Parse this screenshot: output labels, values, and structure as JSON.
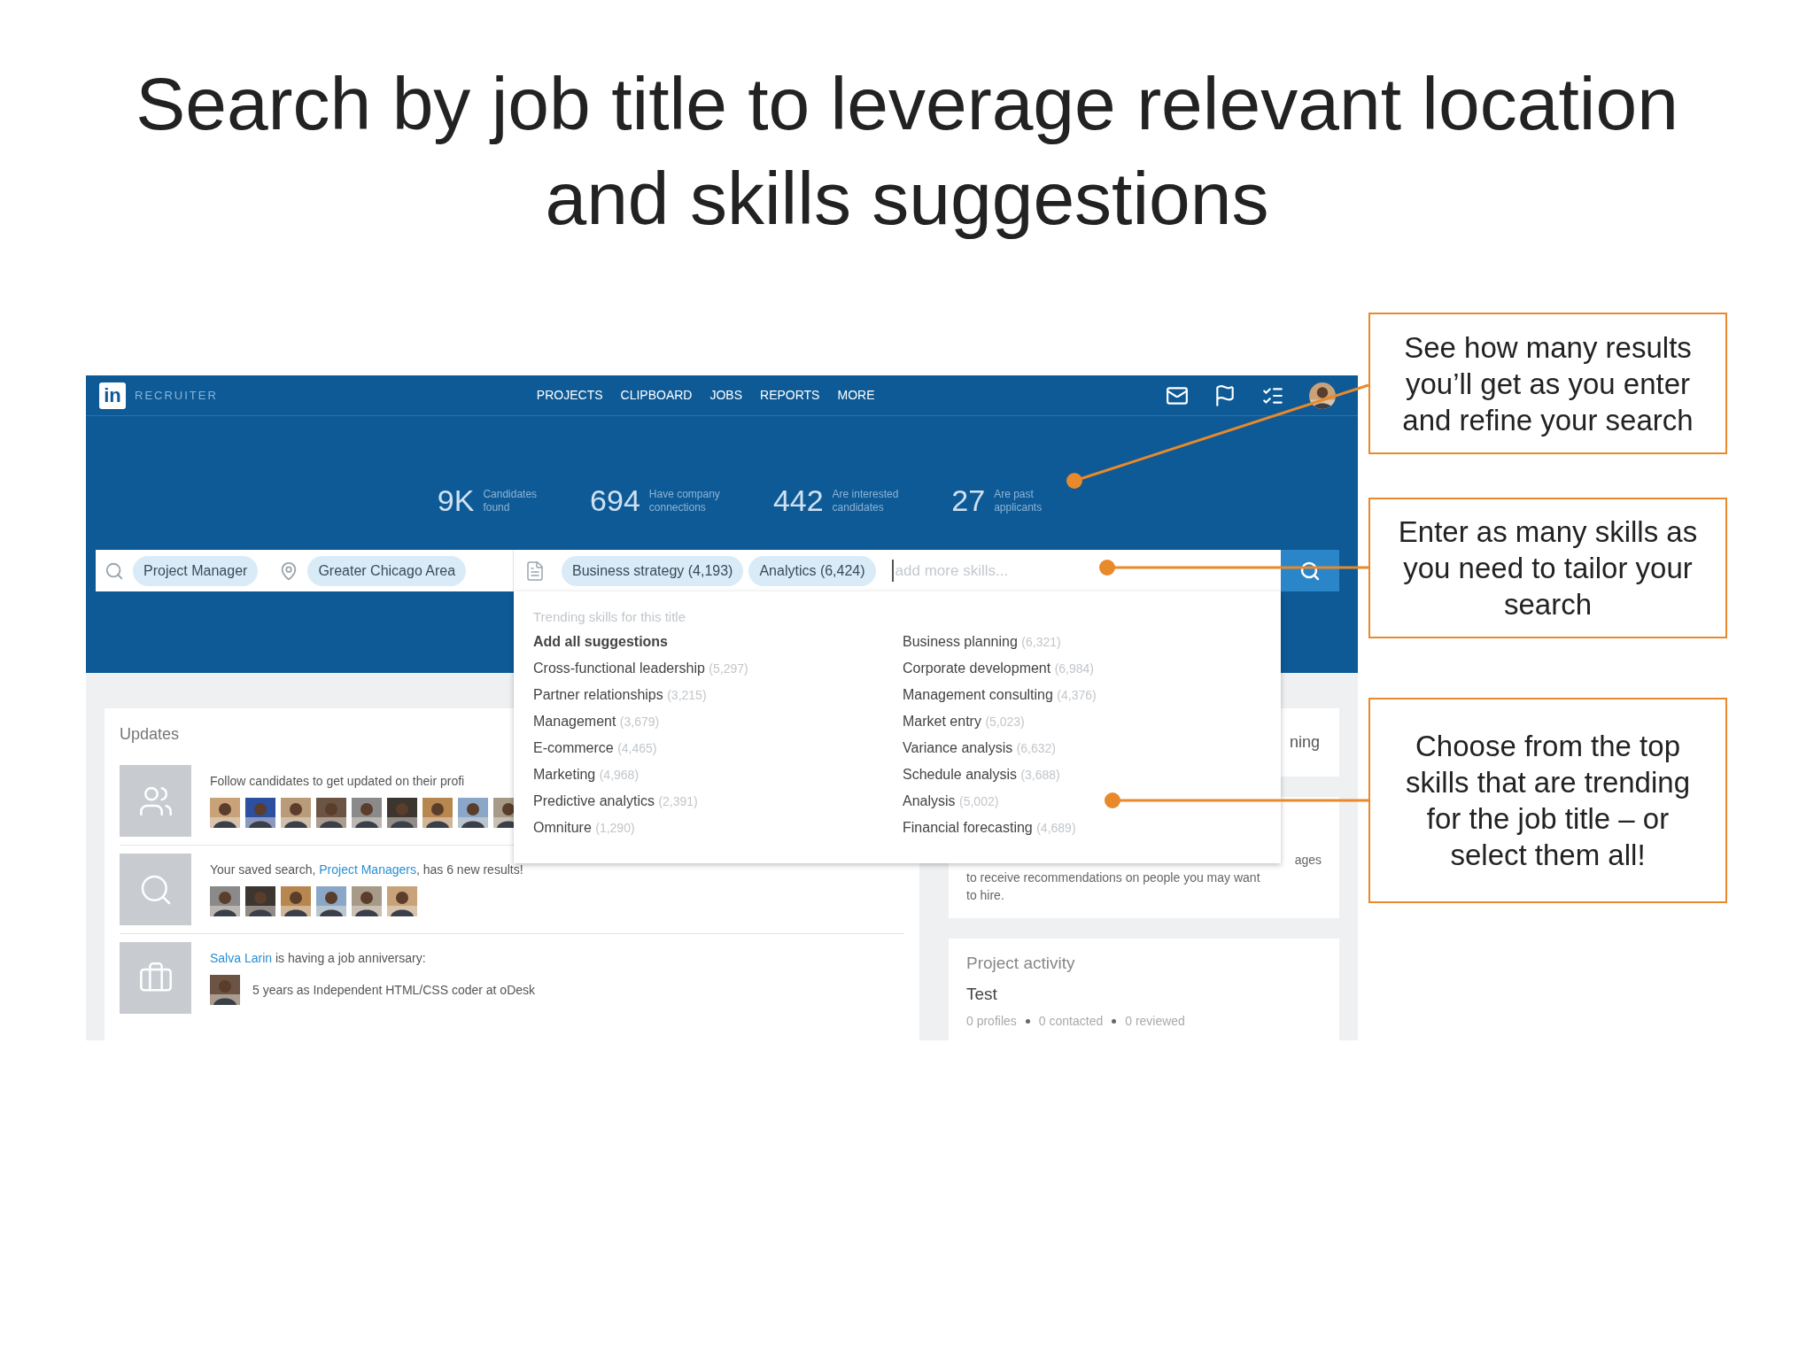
{
  "slide": {
    "title_lines": [
      "Search by job title to leverage relevant location",
      "and skills suggestions"
    ]
  },
  "app": {
    "logo": "in",
    "brand": "RECRUITER",
    "nav": [
      "PROJECTS",
      "CLIPBOARD",
      "JOBS",
      "REPORTS",
      "MORE"
    ],
    "stats": [
      {
        "value": "9K",
        "label": [
          "Candidates",
          "found"
        ]
      },
      {
        "value": "694",
        "label": [
          "Have company",
          "connections"
        ]
      },
      {
        "value": "442",
        "label": [
          "Are interested",
          "candidates"
        ]
      },
      {
        "value": "27",
        "label": [
          "Are past",
          "applicants"
        ]
      }
    ],
    "search": {
      "title_chip": "Project Manager",
      "location_chip": "Greater Chicago Area",
      "skill_chips": [
        "Business strategy (4,193)",
        "Analytics (6,424)"
      ],
      "placeholder": "add more skills..."
    },
    "dropdown": {
      "heading": "Trending skills for this title",
      "add_all": "Add all suggestions",
      "columns": [
        [
          {
            "name": "Cross-functional leadership",
            "count": "(5,297)"
          },
          {
            "name": "Partner relationships",
            "count": "(3,215)"
          },
          {
            "name": "Management",
            "count": "(3,679)"
          },
          {
            "name": "E-commerce",
            "count": "(4,465)"
          },
          {
            "name": "Marketing",
            "count": "(4,968)"
          },
          {
            "name": "Predictive analytics",
            "count": "(2,391)"
          },
          {
            "name": "Omniture",
            "count": "(1,290)"
          }
        ],
        [
          {
            "name": "Business planning",
            "count": "(6,321)"
          },
          {
            "name": "Corporate development",
            "count": "(6,984)"
          },
          {
            "name": "Management consulting",
            "count": "(4,376)"
          },
          {
            "name": "Market entry",
            "count": "(5,023)"
          },
          {
            "name": "Variance analysis",
            "count": "(6,632)"
          },
          {
            "name": "Schedule analysis",
            "count": "(3,688)"
          },
          {
            "name": "Analysis",
            "count": "(5,002)"
          },
          {
            "name": "Financial forecasting",
            "count": "(4,689)"
          }
        ]
      ]
    },
    "updates": {
      "title": "Updates",
      "items": [
        {
          "kind": "follow",
          "text": "Follow candidates to get updated on their profi",
          "photos": [
            {
              "color": "#c9a27a"
            },
            {
              "color": "#2c4fa0"
            },
            {
              "color": "#b99b7a"
            },
            {
              "color": "#6b5443"
            },
            {
              "color": "#8a8a8a"
            },
            {
              "color": "#3d3530"
            },
            {
              "color": "#b8874f"
            },
            {
              "color": "#8aa7c8"
            },
            {
              "color": "#a89a88"
            }
          ]
        },
        {
          "kind": "search",
          "before": "Your saved search, ",
          "link": "Project Managers",
          "after": ", has 6 new results!",
          "photos": [
            {
              "color": "#8a8a8a"
            },
            {
              "color": "#3d3530"
            },
            {
              "color": "#b8874f"
            },
            {
              "color": "#8aa7c8"
            },
            {
              "color": "#a89a88"
            },
            {
              "color": "#c9a27a"
            }
          ]
        },
        {
          "kind": "anniversary",
          "link": "Salva Larin",
          "after": " is having a job anniversary:",
          "detail": "5 years as Independent HTML/CSS coder at oDesk",
          "photos": [
            {
              "color": "#6b5443"
            }
          ]
        }
      ]
    },
    "side_cards": {
      "first": "ning",
      "second": [
        "ages",
        "to receive recommendations on people you may want",
        "to hire."
      ],
      "activity": {
        "title": "Project activity",
        "project": "Test",
        "stats": [
          "0 profiles",
          "0 contacted",
          "0 reviewed"
        ]
      }
    }
  },
  "callouts": [
    {
      "lines": [
        "See how many results",
        "you’ll get as you enter",
        "and refine your search"
      ]
    },
    {
      "lines": [
        "Enter as many skills as",
        "you need to tailor your",
        "search"
      ]
    },
    {
      "lines": [
        "Choose from the top",
        "skills that are trending",
        "for the job title – or",
        "select them all!"
      ]
    }
  ]
}
